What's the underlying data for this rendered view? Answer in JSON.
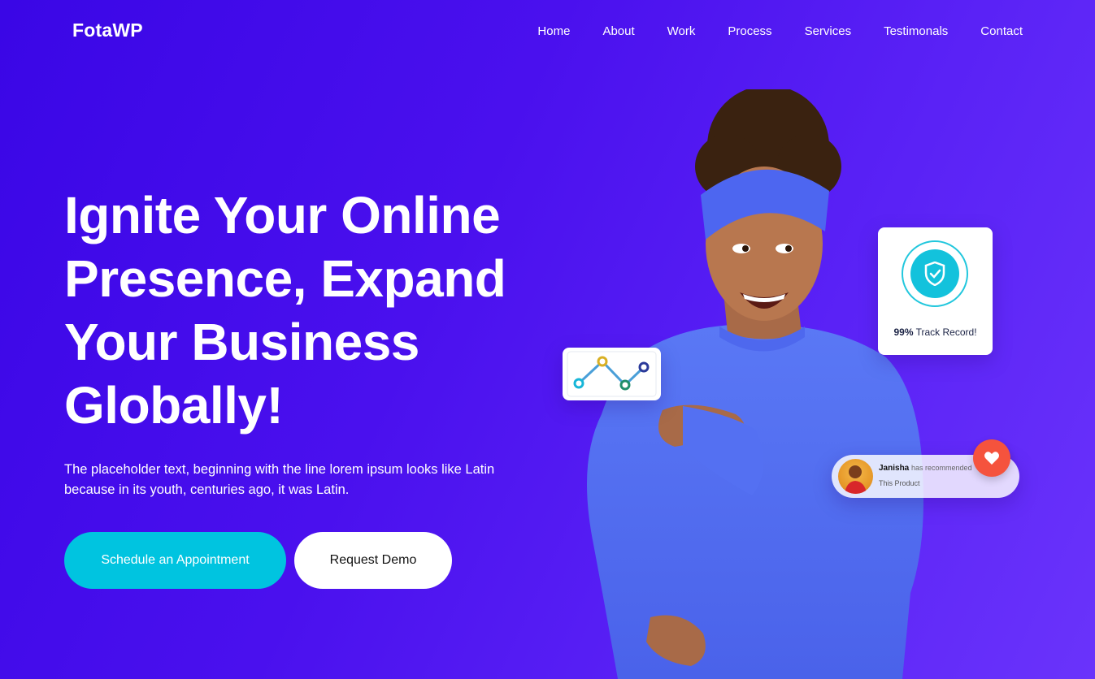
{
  "header": {
    "logo": "FotaWP",
    "nav": [
      "Home",
      "About",
      "Work",
      "Process",
      "Services",
      "Testimonals",
      "Contact"
    ]
  },
  "hero": {
    "title_lines": [
      "Ignite Your Online",
      "Presence, Expand",
      "Your Business",
      "Globally!"
    ],
    "subtitle_line1": "The placeholder text, beginning with the line lorem ipsum looks like Latin",
    "subtitle_line2": "because in its youth, centuries ago, it was Latin.",
    "primary_button": "Schedule an Appointment",
    "secondary_button": "Request Demo"
  },
  "cards": {
    "track_percent": "99%",
    "track_label": "Track Record!",
    "recommend_name": "Janisha",
    "recommend_text": "has recommended",
    "recommend_product": "This Product"
  },
  "icons": {
    "shield": "shield-check-icon",
    "heart": "heart-icon",
    "chart": "line-chart-icon"
  },
  "colors": {
    "accent": "#00c4e0",
    "background_start": "#3a06e6",
    "background_end": "#6a33fb",
    "heart": "#f5533d"
  }
}
